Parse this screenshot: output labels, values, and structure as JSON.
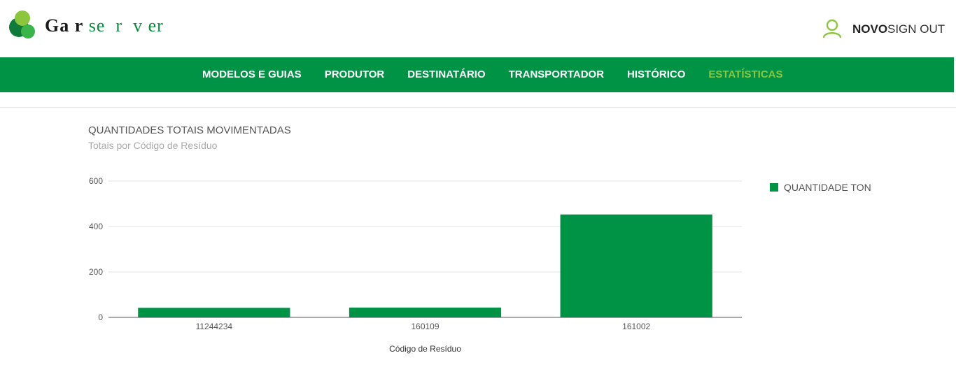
{
  "brand": {
    "part1": "Ga r",
    "part2": " se  r  v er"
  },
  "user": {
    "name": "NOVO",
    "signout_label": "SIGN OUT"
  },
  "nav": {
    "items": [
      {
        "label": "MODELOS E GUIAS",
        "active": false
      },
      {
        "label": "PRODUTOR",
        "active": false
      },
      {
        "label": "DESTINATÁRIO",
        "active": false
      },
      {
        "label": "TRANSPORTADOR",
        "active": false
      },
      {
        "label": "HISTÓRICO",
        "active": false
      },
      {
        "label": "ESTATÍSTICAS",
        "active": true
      }
    ]
  },
  "card": {
    "title": "QUANTIDADES TOTAIS MOVIMENTADAS",
    "subtitle": "Totais por Código de Resíduo"
  },
  "colors": {
    "brand_green": "#009245",
    "accent_lime": "#8cc63f"
  },
  "chart_data": {
    "type": "bar",
    "categories": [
      "11244234",
      "160109",
      "161002"
    ],
    "series": [
      {
        "name": "QUANTIDADE TON",
        "values": [
          42,
          43,
          453
        ]
      }
    ],
    "title": "",
    "xlabel": "Código de Resíduo",
    "ylabel": "",
    "ylim": [
      0,
      600
    ],
    "yticks": [
      0,
      200,
      400,
      600
    ],
    "grid": true,
    "legend": "right"
  }
}
